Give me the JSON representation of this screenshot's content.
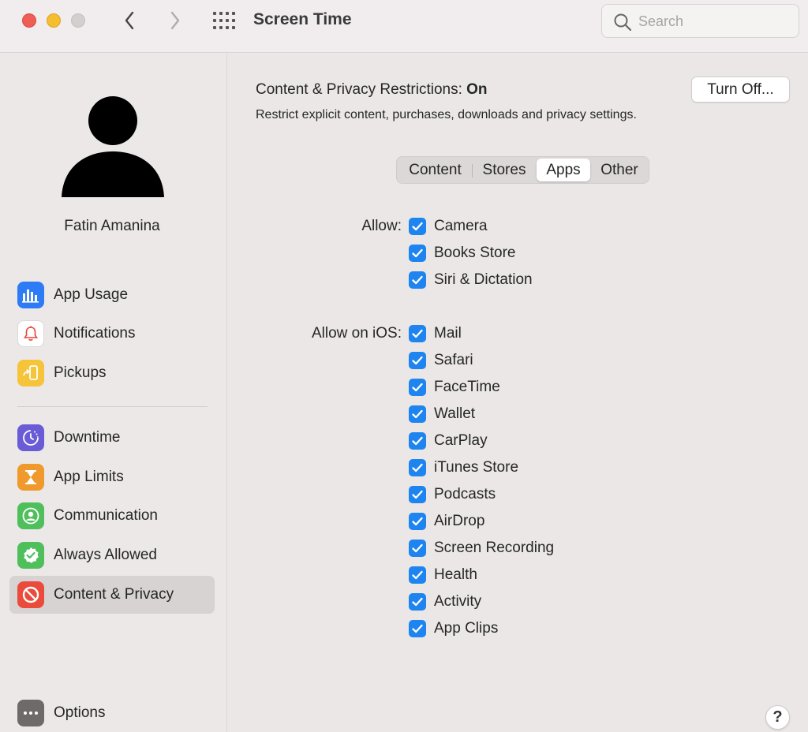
{
  "window": {
    "title": "Screen Time",
    "search_placeholder": "Search"
  },
  "toolbar_icons": [
    "close-light",
    "minimize-light",
    "zoom-light",
    "chevron-left-icon",
    "chevron-right-icon",
    "grid-icon",
    "search-icon"
  ],
  "sidebar": {
    "user_name": "Fatin Amanina",
    "items": [
      {
        "label": "App Usage",
        "icon": "bar-chart-icon",
        "color": "#2d7cf6"
      },
      {
        "label": "Notifications",
        "icon": "bell-icon",
        "color": "#ffffff"
      },
      {
        "label": "Pickups",
        "icon": "phone-pickup-icon",
        "color": "#f6c43b"
      },
      {
        "label": "Downtime",
        "icon": "downtime-icon",
        "color": "#6a5cd6"
      },
      {
        "label": "App Limits",
        "icon": "hourglass-icon",
        "color": "#f09a2e"
      },
      {
        "label": "Communication",
        "icon": "person-circle-icon",
        "color": "#4fbf5c"
      },
      {
        "label": "Always Allowed",
        "icon": "checkmark-badge-icon",
        "color": "#4fbf5c"
      },
      {
        "label": "Content & Privacy",
        "icon": "no-entry-icon",
        "color": "#ea4b3b"
      },
      {
        "label": "Options",
        "icon": "ellipsis-icon",
        "color": "#6e6a6a"
      }
    ],
    "selected": "Content & Privacy"
  },
  "main": {
    "restrictions_label": "Content & Privacy Restrictions:",
    "restrictions_state": "On",
    "description": "Restrict explicit content, purchases, downloads and privacy settings.",
    "turn_off_label": "Turn Off...",
    "tabs": [
      {
        "label": "Content"
      },
      {
        "label": "Stores"
      },
      {
        "label": "Apps"
      },
      {
        "label": "Other"
      }
    ],
    "active_tab": "Apps",
    "allow_label": "Allow:",
    "allow_items": [
      {
        "label": "Camera",
        "checked": true
      },
      {
        "label": "Books Store",
        "checked": true
      },
      {
        "label": "Siri & Dictation",
        "checked": true
      }
    ],
    "allow_ios_label": "Allow on iOS:",
    "allow_ios_items": [
      {
        "label": "Mail",
        "checked": true
      },
      {
        "label": "Safari",
        "checked": true
      },
      {
        "label": "FaceTime",
        "checked": true
      },
      {
        "label": "Wallet",
        "checked": true
      },
      {
        "label": "CarPlay",
        "checked": true
      },
      {
        "label": "iTunes Store",
        "checked": true
      },
      {
        "label": "Podcasts",
        "checked": true
      },
      {
        "label": "AirDrop",
        "checked": true
      },
      {
        "label": "Screen Recording",
        "checked": true
      },
      {
        "label": "Health",
        "checked": true
      },
      {
        "label": "Activity",
        "checked": true
      },
      {
        "label": "App Clips",
        "checked": true
      }
    ],
    "help_label": "?"
  }
}
